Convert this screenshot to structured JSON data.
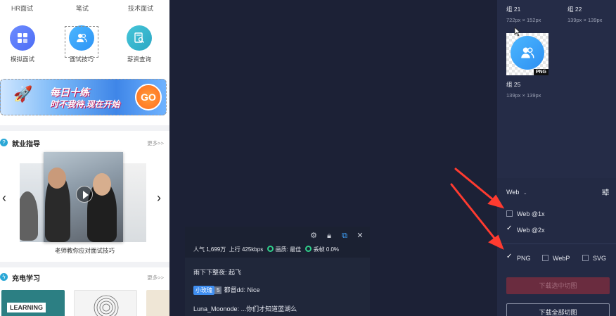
{
  "phone": {
    "top_labels": [
      "HR面试",
      "笔试",
      "技术面试"
    ],
    "icons": [
      {
        "label": "模拟面试",
        "icon": "grid-icon"
      },
      {
        "label": "面试技巧",
        "icon": "people-icon"
      },
      {
        "label": "薪资查询",
        "icon": "document-search-icon"
      }
    ],
    "banner": {
      "title": "每日十练",
      "subtitle": "时不我待,现在开始",
      "go": "GO"
    },
    "career": {
      "title": "就业指导",
      "more": "更多>>",
      "caption": "老师教你应对面试技巧"
    },
    "study": {
      "title": "充电学习",
      "more": "更多>>",
      "thumb1": "LEARNING"
    }
  },
  "chat": {
    "stats": {
      "popularity_label": "人气",
      "popularity": "1,699万",
      "upload_label": "上行",
      "upload": "425kbps",
      "quality_label": "画质: 最佳",
      "drop_label": "丢帧 0.0%"
    },
    "messages": [
      {
        "user": "雨下下整夜",
        "text": "起飞"
      },
      {
        "badge": "小玫瑰",
        "badge_num": "5",
        "user": "都督dd",
        "text": "Nice"
      },
      {
        "user": "Luna_Moonode",
        "text": "...你们才知道蓝湖么"
      }
    ]
  },
  "panel": {
    "assets": [
      {
        "name": "组 21",
        "size": "722px × 152px"
      },
      {
        "name": "组 22",
        "size": "139px × 139px"
      },
      {
        "name": "组 25",
        "size": "139px × 139px"
      }
    ],
    "thumb_tag": "PNG",
    "format_select": "Web",
    "scales": [
      {
        "label": "Web @1x",
        "checked": false
      },
      {
        "label": "Web @2x",
        "checked": true
      }
    ],
    "formats": [
      {
        "label": "PNG",
        "checked": true
      },
      {
        "label": "WebP",
        "checked": false
      },
      {
        "label": "SVG",
        "checked": false
      }
    ],
    "download_selected": "下载选中切图",
    "download_all": "下载全部切图"
  },
  "colors": {
    "accent": "#3f8ef0",
    "panel_bg": "#252c47",
    "canvas_bg": "#1c2136",
    "arrow": "#ff3b30",
    "disabled_button": "#6a2c3f"
  }
}
